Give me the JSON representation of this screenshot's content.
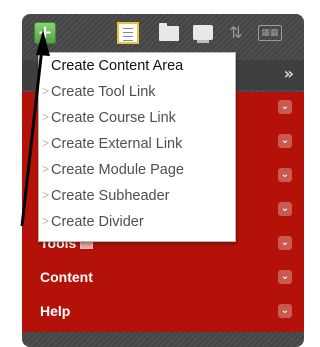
{
  "toolbar": {
    "add_icon": "plus-icon",
    "icons": [
      "list-view-icon",
      "folder-icon",
      "window-icon",
      "reorder-arrows-icon",
      "grid-icon"
    ]
  },
  "collapse_icon": "chevron-right-double-icon",
  "menu": {
    "items": [
      {
        "label": "",
        "chevron": "double-chevron-down-icon"
      },
      {
        "label": "",
        "chevron": "double-chevron-down-icon"
      },
      {
        "label": "",
        "chevron": "double-chevron-down-icon"
      },
      {
        "label": "",
        "chevron": "double-chevron-down-icon"
      },
      {
        "label": "Tools",
        "chevron": "double-chevron-down-icon"
      },
      {
        "label": "Content",
        "chevron": "double-chevron-down-icon"
      },
      {
        "label": "Help",
        "chevron": "double-chevron-down-icon"
      }
    ]
  },
  "dropdown": {
    "items": [
      {
        "label": "Create Content Area"
      },
      {
        "label": "Create Tool Link"
      },
      {
        "label": "Create Course Link"
      },
      {
        "label": "Create External Link"
      },
      {
        "label": "Create Module Page"
      },
      {
        "label": "Create Subheader"
      },
      {
        "label": "Create Divider"
      }
    ]
  },
  "colors": {
    "menu_bg": "#b41208",
    "add_button": "#5db548",
    "toolbar_bg": "#4a4a4a",
    "arrow": "#000000"
  }
}
